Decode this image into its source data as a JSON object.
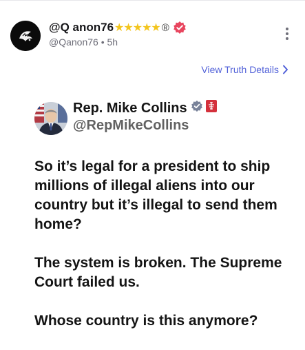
{
  "post": {
    "author_name": "@Q anon76",
    "stars": "★★★★★",
    "registered_mark": "®",
    "handle": "@Qanon76",
    "separator": "•",
    "time": "5h",
    "view_details": "View Truth Details"
  },
  "quoted": {
    "name": "Rep. Mike Collins",
    "handle": "@RepMikeCollins",
    "paragraphs": [
      "So it’s legal for a president to ship millions of illegal aliens into our country but it’s illegal to send them home?",
      "The system is broken. The Supreme Court failed us.",
      "Whose country is this anymore?"
    ]
  },
  "colors": {
    "accent": "#4f5fd8",
    "verified_badge": "#e8455e",
    "star": "#f3c51e",
    "flag_badge": "#d4313c"
  },
  "icons": [
    "avatar-logo",
    "verified-icon",
    "more-options-icon",
    "chevron-right-icon",
    "gray-verified-icon",
    "flag-badge-icon"
  ]
}
